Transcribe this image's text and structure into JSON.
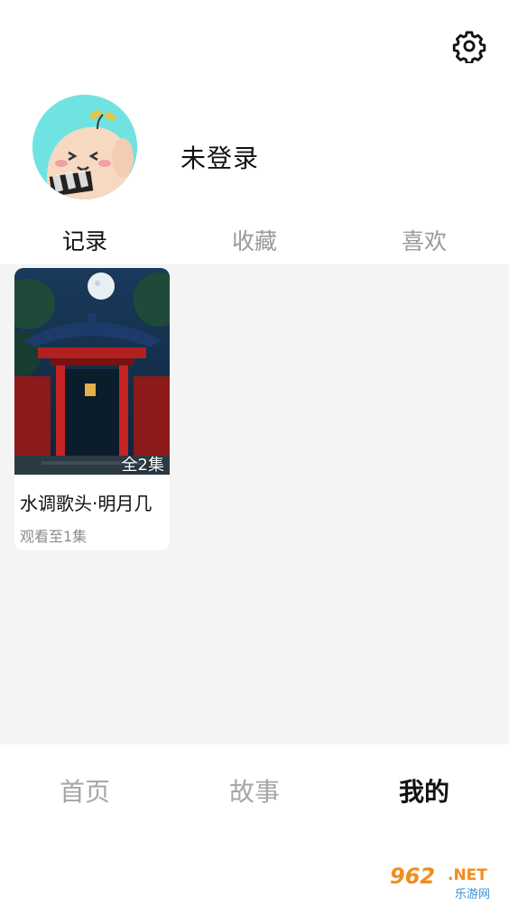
{
  "header": {
    "settings_icon": "gear-icon"
  },
  "profile": {
    "avatar_icon": "cartoon-avatar",
    "username": "未登录"
  },
  "tabs": [
    {
      "label": "记录",
      "active": true
    },
    {
      "label": "收藏",
      "active": false
    },
    {
      "label": "喜欢",
      "active": false
    }
  ],
  "history": [
    {
      "title": "水调歌头·明月几",
      "episodes": "全2集",
      "progress": "观看至1集"
    }
  ],
  "bottom_nav": [
    {
      "label": "首页",
      "active": false
    },
    {
      "label": "故事",
      "active": false
    },
    {
      "label": "我的",
      "active": true
    }
  ],
  "watermark": {
    "text": "962.NET",
    "subtext": "乐游网"
  },
  "colors": {
    "active": "#111111",
    "inactive": "#9a9a9a",
    "content_bg": "#f4f4f4",
    "avatar_bg": "#6fe3e2"
  }
}
